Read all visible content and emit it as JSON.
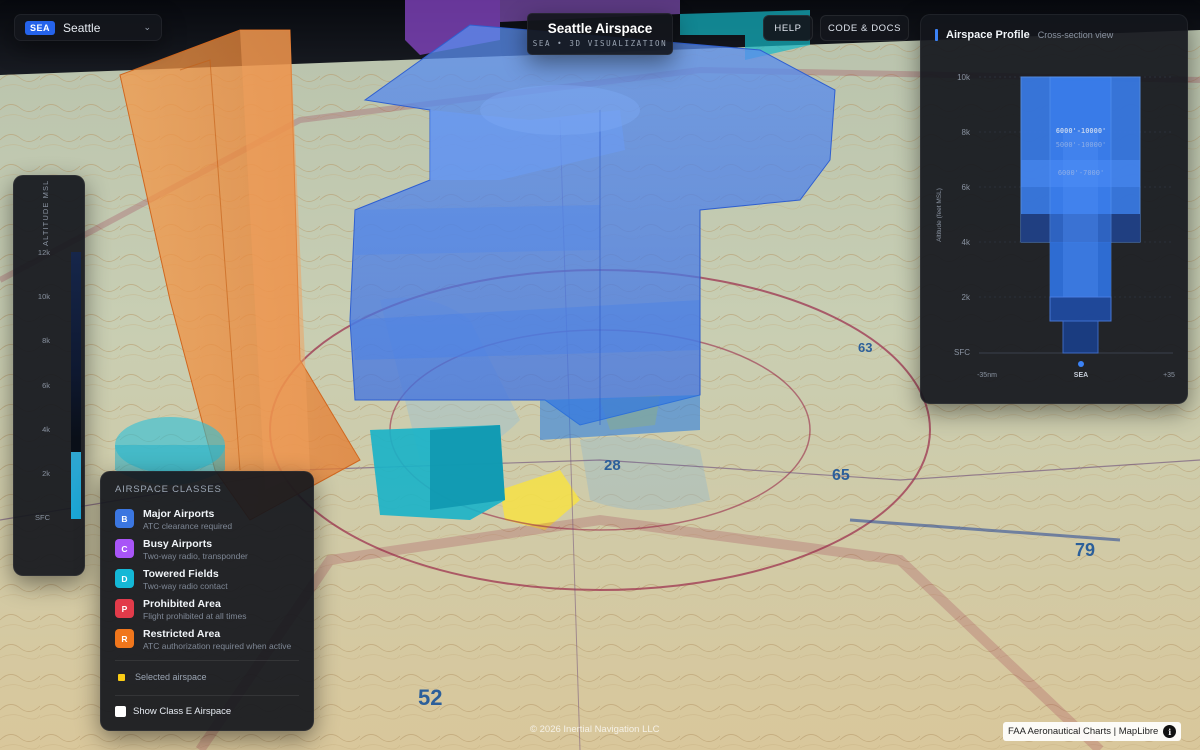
{
  "airport_selector": {
    "code": "SEA",
    "name": "Seattle"
  },
  "header": {
    "title": "Seattle Airspace",
    "subtitle": "SEA • 3D VISUALIZATION"
  },
  "toolbar": {
    "help_label": "HELP",
    "code_label": "CODE & DOCS"
  },
  "altitude_bar": {
    "title": "ALTITUDE MSL",
    "ticks": [
      "12k",
      "10k",
      "8k",
      "6k",
      "4k",
      "2k",
      "SFC"
    ],
    "selected_range_k": [
      0,
      3
    ]
  },
  "profile": {
    "title": "Airspace Profile",
    "subtitle": "Cross-section view",
    "y_label": "Altitude (feet MSL)",
    "y_ticks": [
      "10k",
      "8k",
      "6k",
      "4k",
      "2k",
      "SFC"
    ],
    "x_ticks": [
      "-35nm",
      "SEA",
      "+35"
    ],
    "band_labels": [
      "6000'-10000'",
      "5000'-10000'",
      "6000'-7000'"
    ]
  },
  "legend": {
    "title": "AIRSPACE CLASSES",
    "items": [
      {
        "badge": "B",
        "name": "Major Airports",
        "desc": "ATC clearance required",
        "color": "#3b76e0"
      },
      {
        "badge": "C",
        "name": "Busy Airports",
        "desc": "Two-way radio, transponder",
        "color": "#a855f7"
      },
      {
        "badge": "D",
        "name": "Towered Fields",
        "desc": "Two-way radio contact",
        "color": "#14b8d6"
      },
      {
        "badge": "P",
        "name": "Prohibited Area",
        "desc": "Flight prohibited at all times",
        "color": "#e23b4a"
      },
      {
        "badge": "R",
        "name": "Restricted Area",
        "desc": "ATC authorization required when active",
        "color": "#f0761c"
      }
    ],
    "selected_label": "Selected airspace",
    "class_e_label": "Show Class E Airspace"
  },
  "map_labels": {
    "l65": "65",
    "l63": "63",
    "l79": "79",
    "l28": "28",
    "l52": "52"
  },
  "footer": {
    "copyright": "© 2026 Inertial Navigation LLC",
    "attribution": "FAA Aeronautical Charts | MapLibre"
  }
}
